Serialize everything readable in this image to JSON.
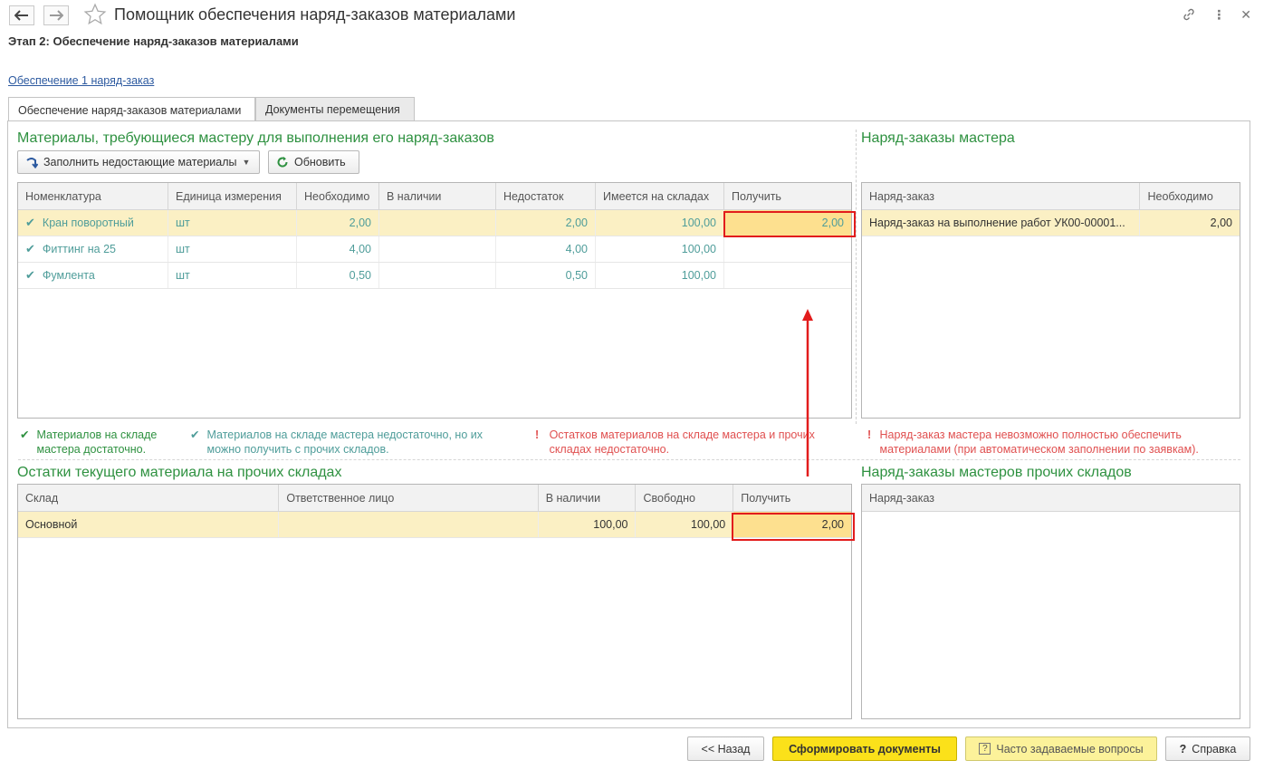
{
  "window": {
    "title": "Помощник обеспечения наряд-заказов материалами"
  },
  "stage_title": "Этап 2: Обеспечение наряд-заказов материалами",
  "supply_link": "Обеспечение 1 наряд-заказ",
  "tabs": [
    {
      "label": "Обеспечение наряд-заказов материалами",
      "active": true
    },
    {
      "label": "Документы перемещения",
      "active": false
    }
  ],
  "materials": {
    "title": "Материалы, требующиеся мастеру для выполнения его наряд-заказов",
    "fill_button": "Заполнить недостающие материалы",
    "refresh_button": "Обновить",
    "columns": [
      "Номенклатура",
      "Единица измерения",
      "Необходимо",
      "В наличии",
      "Недостаток",
      "Имеется на складах",
      "Получить"
    ],
    "rows": [
      {
        "name": "Кран поворотный",
        "unit": "шт",
        "needed": "2,00",
        "in_stock": "",
        "shortage": "2,00",
        "warehouses": "100,00",
        "receive": "2,00"
      },
      {
        "name": "Фиттинг на 25",
        "unit": "шт",
        "needed": "4,00",
        "in_stock": "",
        "shortage": "4,00",
        "warehouses": "100,00",
        "receive": ""
      },
      {
        "name": "Фумлента",
        "unit": "шт",
        "needed": "0,50",
        "in_stock": "",
        "shortage": "0,50",
        "warehouses": "100,00",
        "receive": ""
      }
    ]
  },
  "orders": {
    "title": "Наряд-заказы мастера",
    "columns": [
      "Наряд-заказ",
      "Необходимо"
    ],
    "rows": [
      {
        "order": "Наряд-заказ на выполнение работ УК00-00001...",
        "needed": "2,00"
      }
    ]
  },
  "legend": {
    "ok": "Материалов на складе мастера достаточно.",
    "partial": "Материалов на складе мастера недостаточно, но их можно получить с прочих складов.",
    "insufficient": "Остатков материалов на складе мастера и прочих складах недостаточно.",
    "order_warning": "Наряд-заказ мастера невозможно полностью обеспечить материалами (при автоматическом заполнении по заявкам)."
  },
  "stock": {
    "title": "Остатки текущего материала на прочих складах",
    "columns": [
      "Склад",
      "Ответственное лицо",
      "В наличии",
      "Свободно",
      "Получить"
    ],
    "rows": [
      {
        "warehouse": "Основной",
        "responsible": "",
        "in_stock": "100,00",
        "free": "100,00",
        "receive": "2,00"
      }
    ]
  },
  "other_orders": {
    "title": "Наряд-заказы мастеров прочих складов",
    "columns": [
      "Наряд-заказ"
    ]
  },
  "footer": {
    "back": "<< Назад",
    "create": "Сформировать документы",
    "faq": "Часто задаваемые вопросы",
    "help": "Справка"
  },
  "colors": {
    "section_green": "#2e9140",
    "teal_text": "#4f9d9a",
    "warning_red": "#e05050",
    "selected_row": "#fbf0c4",
    "highlight_cell": "#fde08f",
    "primary_button": "#fbe11a",
    "annotation_red": "#e21c1c"
  }
}
